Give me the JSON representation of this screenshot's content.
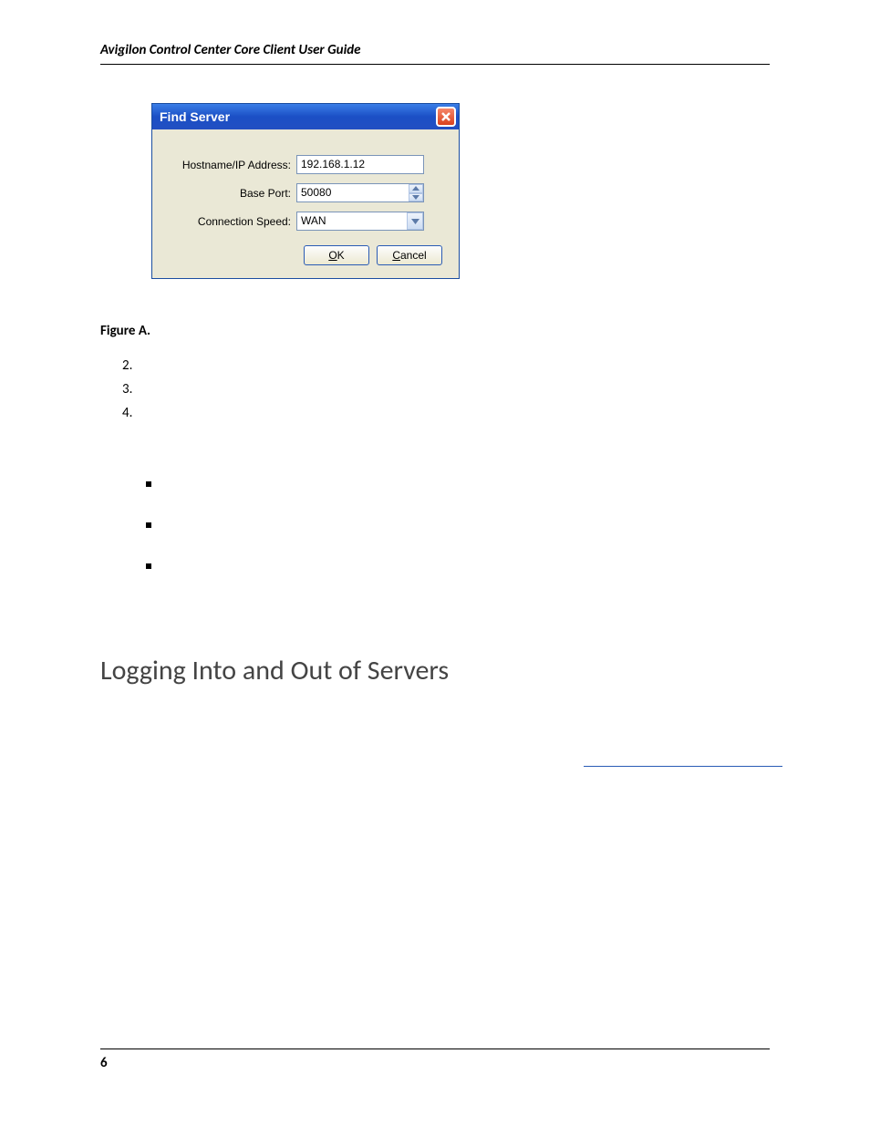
{
  "header": {
    "running": "Avigilon Control Center Core Client User Guide"
  },
  "dialog": {
    "title": "Find Server",
    "labels": {
      "hostname": "Hostname/IP Address:",
      "baseport": "Base Port:",
      "connspeed": "Connection Speed:"
    },
    "values": {
      "hostname": "192.168.1.12",
      "baseport": "50080",
      "connspeed": "WAN"
    },
    "buttons": {
      "ok_pre": "",
      "ok_u": "O",
      "ok_post": "K",
      "cancel_pre": "",
      "cancel_u": "C",
      "cancel_post": "ancel"
    }
  },
  "figure": {
    "label": "Figure A."
  },
  "numbered": {
    "n2": "2.",
    "n3": "3.",
    "n4": "4."
  },
  "heading": "Logging Into and Out of Servers",
  "footer": {
    "page": "6"
  }
}
